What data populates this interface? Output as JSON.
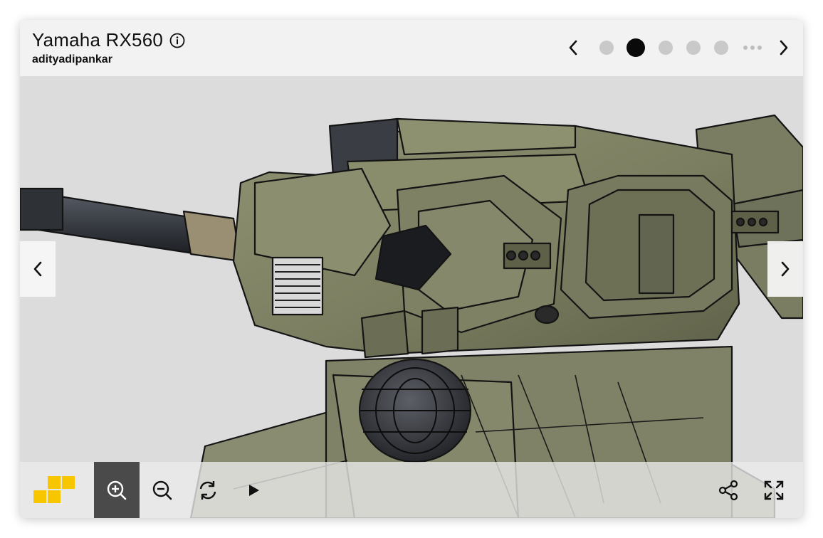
{
  "header": {
    "title": "Yamaha RX560",
    "author": "adityadipankar",
    "info_icon": "info-icon"
  },
  "pager": {
    "pages": 5,
    "active_index": 1,
    "prev_icon": "chevron-left-icon",
    "next_icon": "chevron-right-icon",
    "more_icon": "more-horizontal-icon"
  },
  "viewer": {
    "background": "#dcdcdc",
    "prev_icon": "chevron-left-icon",
    "next_icon": "chevron-right-icon"
  },
  "toolbar": {
    "logo_color": "#f8c600",
    "tools": [
      {
        "name": "zoom-in",
        "icon": "zoom-in-icon",
        "active": true
      },
      {
        "name": "zoom-out",
        "icon": "zoom-out-icon",
        "active": false
      },
      {
        "name": "reset-rotation",
        "icon": "rotate-icon",
        "active": false
      },
      {
        "name": "play",
        "icon": "play-icon",
        "active": false
      },
      {
        "name": "share",
        "icon": "share-icon",
        "active": false
      },
      {
        "name": "fullscreen",
        "icon": "fullscreen-icon",
        "active": false
      }
    ]
  }
}
